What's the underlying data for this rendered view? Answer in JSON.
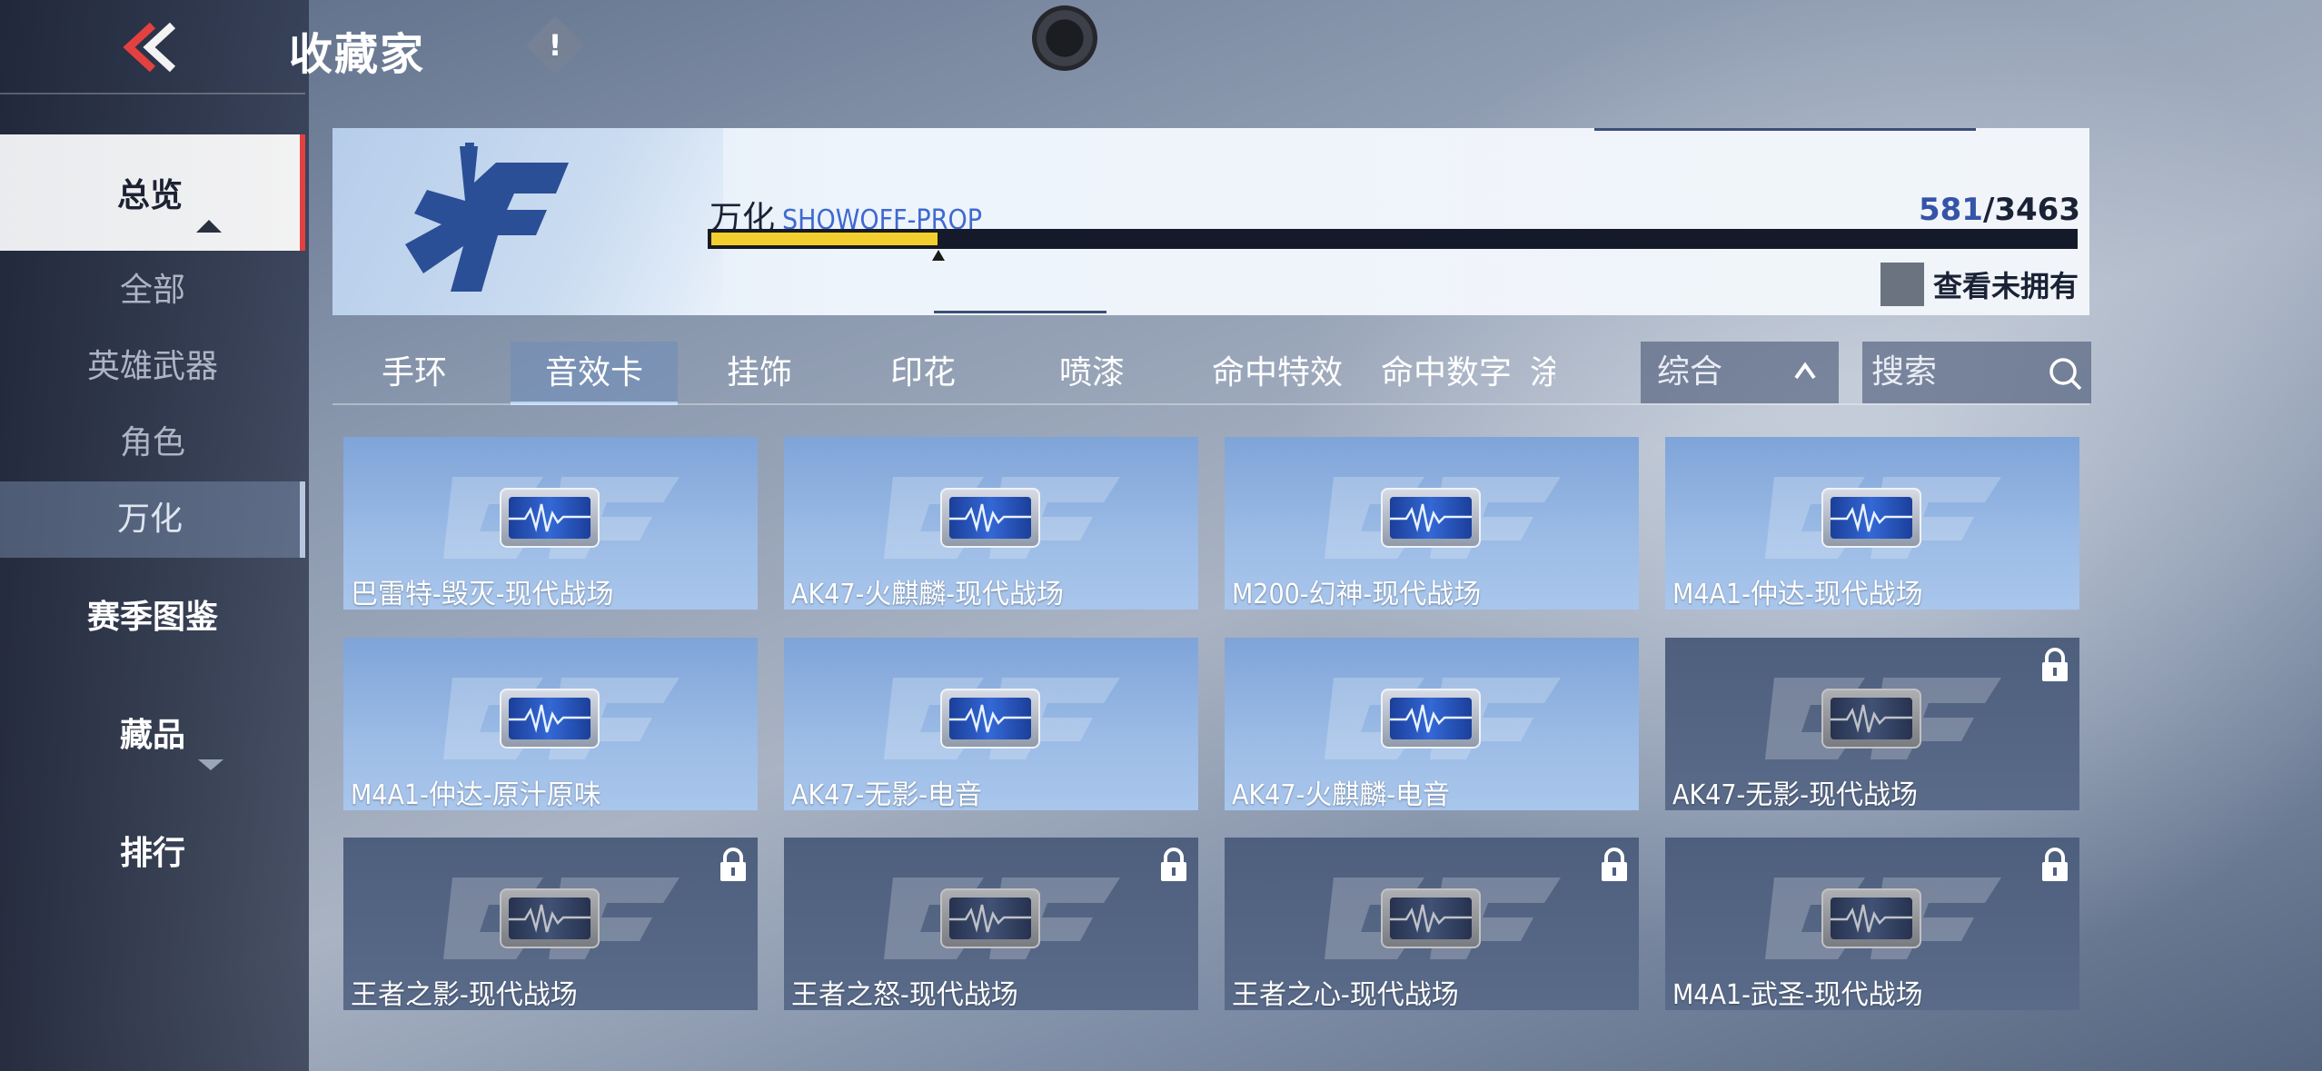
{
  "header": {
    "title": "收藏家",
    "info_icon": "!"
  },
  "sidebar": {
    "items": [
      {
        "label": "总览"
      },
      {
        "label": "全部"
      },
      {
        "label": "英雄武器"
      },
      {
        "label": "角色"
      },
      {
        "label": "万化"
      },
      {
        "label": "赛季图鉴"
      },
      {
        "label": "藏品"
      },
      {
        "label": "排行"
      }
    ]
  },
  "banner": {
    "category_cn": "万化",
    "category_en": "SHOWOFF-PROP",
    "owned": "581",
    "separator": "/",
    "total": "3463",
    "progress_fraction": 0.168,
    "view_unowned_label": "查看未拥有"
  },
  "tabs": [
    "手环",
    "音效卡",
    "挂饰",
    "印花",
    "喷漆",
    "命中特效",
    "命中数字",
    "涂"
  ],
  "active_tab": "音效卡",
  "sort": {
    "label": "综合"
  },
  "search": {
    "placeholder": "搜索"
  },
  "cards": [
    {
      "name": "巴雷特-毁灭-现代战场",
      "locked": false
    },
    {
      "name": "AK47-火麒麟-现代战场",
      "locked": false
    },
    {
      "name": "M200-幻神-现代战场",
      "locked": false
    },
    {
      "name": "M4A1-仲达-现代战场",
      "locked": false
    },
    {
      "name": "M4A1-仲达-原汁原味",
      "locked": false
    },
    {
      "name": "AK47-无影-电音",
      "locked": false
    },
    {
      "name": "AK47-火麒麟-电音",
      "locked": false
    },
    {
      "name": "AK47-无影-现代战场",
      "locked": true
    },
    {
      "name": "王者之影-现代战场",
      "locked": true
    },
    {
      "name": "王者之怒-现代战场",
      "locked": true
    },
    {
      "name": "王者之心-现代战场",
      "locked": true
    },
    {
      "name": "M4A1-武圣-现代战场",
      "locked": true
    }
  ],
  "colors": {
    "accent_red": "#e3413f",
    "progress_yellow": "#f2cf2e",
    "owned_card": "#9cbce6",
    "locked_card": "#56667f"
  }
}
